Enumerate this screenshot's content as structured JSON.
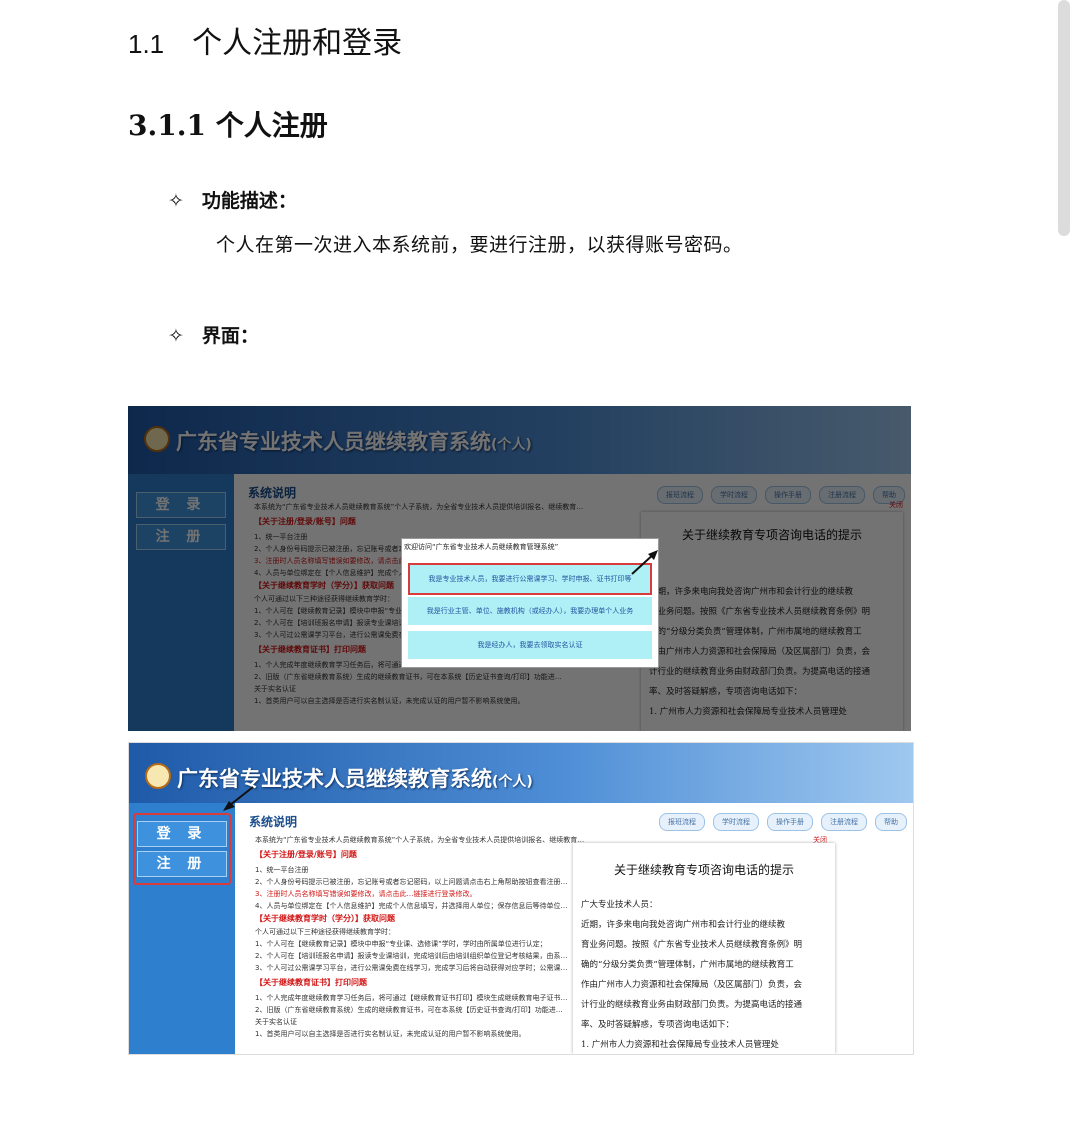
{
  "doc": {
    "h1_number": "1.1",
    "h1_title": "个人注册和登录",
    "h2": "3.1.1 个人注册",
    "bullet_glyph": "✧",
    "func_label": "功能描述：",
    "func_desc": "个人在第一次进入本系统前，要进行注册，以获得账号密码。",
    "ui_label": "界面："
  },
  "shot": {
    "system_title": "广东省专业技术人员继续教育系统",
    "system_title_suffix": "(个人)",
    "login_button": "登 录",
    "register_button": "注 册",
    "section_title": "系统说明",
    "tabs": [
      "报班流程",
      "学时流程",
      "操作手册",
      "注册流程",
      "帮助"
    ],
    "close_label": "关闭",
    "intro_line": "本系统为“广东省专业技术人员继续教育系统”个人子系统，为全省专业技术人员提供培训报名、继续教育…",
    "faq1_head": "【关于注册/登录/账号】问题",
    "faq1_lines": [
      "1、统一平台注册",
      "2、个人身份号码提示已被注册，忘记账号或者忘记密码，以上问题请点击右上角帮助按钮查看注册…",
      "3、注册时人员名称填写错误如要修改，请点击此…链接进行登录修改。",
      "4、人员与单位绑定在【个人信息维护】完成个人信息填写，并选择用人单位；保存信息后等待单位…"
    ],
    "faq2_head": "【关于继续教育学时（学分）】获取问题",
    "faq2_lines": [
      "个人可通过以下三种途径获得继续教育学时：",
      "1、个人可在【继续教育记录】模块中申报“专业课、选修课”学时，学时由所属单位进行认定；",
      "2、个人可在【培训班报名申请】报读专业课培训，完成培训后由培训组织单位登记考核结果，由系…",
      "3、个人可过公需课学习平台，进行公需课免费在线学习，完成学习后将自动获得对应学时；公需课…"
    ],
    "faq3_head": "【关于继续教育证书】打印问题",
    "faq3_lines": [
      "1、个人完成年度继续教育学习任务后，将可通过【继续教育证书打印】模块生成继续教育电子证书…",
      "2、旧版（广东省继续教育系统）生成的继续教育证书，可在本系统【历史证书查询/打印】功能进…",
      "关于实名认证",
      "1、首类用户可以自主选择是否进行实名制认证，未完成认证的用户暂不影响系统使用。"
    ],
    "notice_title": "关于继续教育专项咨询电话的提示",
    "notice_greeting": "广大专业技术人员：",
    "notice_lines": [
      "近期，许多来电向我处咨询广州市和会计行业的继续教",
      "育业务问题。按照《广东省专业技术人员继续教育条例》明",
      "确的“分级分类负责”管理体制，广州市属地的继续教育工",
      "作由广州市人力资源和社会保障局（及区属部门）负责，会",
      "计行业的继续教育业务由财政部门负责。为提高电话的接通",
      "率、及时答疑解惑，专项咨询电话如下：",
      "1. 广州市人力资源和社会保障局专业技术人员管理处"
    ],
    "modal_title": "欢迎访问“广东省专业技术人员继续教育管理系统”",
    "modal_items": [
      "我是专业技术人员，我要进行公需课学习、学时申报、证书打印等",
      "我是行业主管、单位、施教机构（或经办人），我要办理单个人业务",
      "我是经办人，我要去领取实名认证"
    ]
  }
}
